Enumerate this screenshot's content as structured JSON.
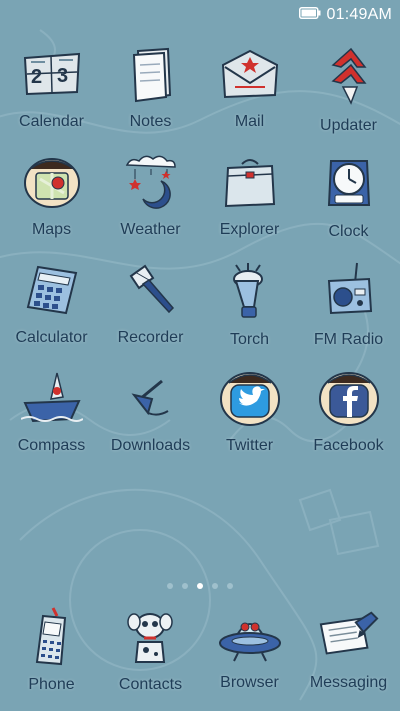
{
  "status_bar": {
    "time": "01:49AM",
    "battery_level": 1.0
  },
  "apps": [
    {
      "label": "Calendar",
      "icon": "calendar-icon"
    },
    {
      "label": "Notes",
      "icon": "notes-icon"
    },
    {
      "label": "Mail",
      "icon": "mail-icon"
    },
    {
      "label": "Updater",
      "icon": "updater-icon"
    },
    {
      "label": "Maps",
      "icon": "maps-icon"
    },
    {
      "label": "Weather",
      "icon": "weather-icon"
    },
    {
      "label": "Explorer",
      "icon": "explorer-icon"
    },
    {
      "label": "Clock",
      "icon": "clock-icon"
    },
    {
      "label": "Calculator",
      "icon": "calculator-icon"
    },
    {
      "label": "Recorder",
      "icon": "recorder-icon"
    },
    {
      "label": "Torch",
      "icon": "torch-icon"
    },
    {
      "label": "FM Radio",
      "icon": "radio-icon"
    },
    {
      "label": "Compass",
      "icon": "compass-icon"
    },
    {
      "label": "Downloads",
      "icon": "downloads-icon"
    },
    {
      "label": "Twitter",
      "icon": "twitter-icon"
    },
    {
      "label": "Facebook",
      "icon": "facebook-icon"
    }
  ],
  "page_indicator": {
    "pages": 5,
    "current": 3
  },
  "dock": [
    {
      "label": "Phone",
      "icon": "phone-icon"
    },
    {
      "label": "Contacts",
      "icon": "contacts-icon"
    },
    {
      "label": "Browser",
      "icon": "browser-icon"
    },
    {
      "label": "Messaging",
      "icon": "messaging-icon"
    }
  ],
  "colors": {
    "background": "#7aa4b4",
    "label": "#1f3d57",
    "accent_red": "#d0312d"
  }
}
